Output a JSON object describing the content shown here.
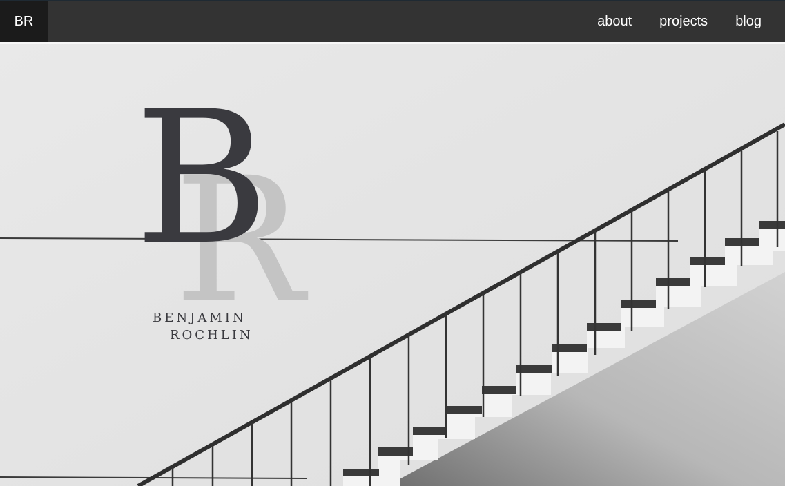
{
  "header": {
    "brand": "BR",
    "nav": [
      {
        "label": "about"
      },
      {
        "label": "projects"
      },
      {
        "label": "blog"
      }
    ]
  },
  "hero": {
    "logo_letter_front": "B",
    "logo_letter_back": "R",
    "name_first": "BENJAMIN",
    "name_last": "ROCHLIN"
  },
  "colors": {
    "topbar": "#333333",
    "brand_bg": "#1b1b1b",
    "hero_bg": "#e6e6e6",
    "logo_dark": "#3a3a3f",
    "logo_light": "#c4c4c4"
  }
}
